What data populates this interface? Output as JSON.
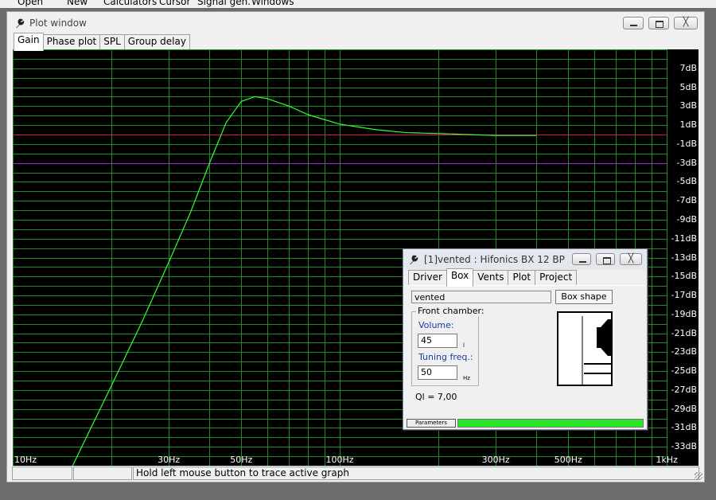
{
  "menu": {
    "items": [
      {
        "label": "Open"
      },
      {
        "label": "New"
      },
      {
        "label": "Calculators"
      },
      {
        "label": "Cursor"
      },
      {
        "label": "Signal gen."
      },
      {
        "label": "Windows"
      }
    ]
  },
  "plot_window": {
    "title": "Plot window",
    "tabs": [
      {
        "label": "Gain",
        "active": true
      },
      {
        "label": "Phase plot",
        "active": false
      },
      {
        "label": "SPL",
        "active": false
      },
      {
        "label": "Group delay",
        "active": false
      }
    ],
    "close_glyph": "╳",
    "status": {
      "cell1": "",
      "cell2": "",
      "message": "Hold left mouse button to trace active graph"
    }
  },
  "chart_data": {
    "type": "line",
    "x_scale": "log",
    "xlim": [
      10,
      1000
    ],
    "ylim": [
      -35,
      9
    ],
    "x_tick_labels": [
      {
        "value": 10,
        "label": "10Hz"
      },
      {
        "value": 30,
        "label": "30Hz"
      },
      {
        "value": 50,
        "label": "50Hz"
      },
      {
        "value": 100,
        "label": "100Hz"
      },
      {
        "value": 300,
        "label": "300Hz"
      },
      {
        "value": 500,
        "label": "500Hz"
      },
      {
        "value": 1000,
        "label": "1kHz"
      }
    ],
    "y_tick_labels": [
      {
        "value": 7,
        "label": "7dB"
      },
      {
        "value": 5,
        "label": "5dB"
      },
      {
        "value": 3,
        "label": "3dB"
      },
      {
        "value": 1,
        "label": "1dB"
      },
      {
        "value": -1,
        "label": "-1dB"
      },
      {
        "value": -3,
        "label": "-3dB"
      },
      {
        "value": -5,
        "label": "-5dB"
      },
      {
        "value": -7,
        "label": "-7dB"
      },
      {
        "value": -9,
        "label": "-9dB"
      },
      {
        "value": -11,
        "label": "-11dB"
      },
      {
        "value": -13,
        "label": "-13dB"
      },
      {
        "value": -15,
        "label": "-15dB"
      },
      {
        "value": -17,
        "label": "-17dB"
      },
      {
        "value": -19,
        "label": "-19dB"
      },
      {
        "value": -21,
        "label": "-21dB"
      },
      {
        "value": -23,
        "label": "-23dB"
      },
      {
        "value": -25,
        "label": "-25dB"
      },
      {
        "value": -27,
        "label": "-27dB"
      },
      {
        "value": -29,
        "label": "-29dB"
      },
      {
        "value": -31,
        "label": "-31dB"
      },
      {
        "value": -33,
        "label": "-33dB"
      }
    ],
    "grid": true,
    "reference_lines": [
      {
        "y": 0,
        "color": "#d02030"
      },
      {
        "y": -3,
        "color": "#a030c0"
      }
    ],
    "series": [
      {
        "color": "#33ff33",
        "x": [
          15,
          20,
          25,
          30,
          35,
          40,
          45,
          50,
          55,
          60,
          70,
          80,
          100,
          130,
          160,
          200,
          250,
          300,
          400
        ],
        "y": [
          -35.5,
          -26.6,
          -19.6,
          -13.5,
          -8.2,
          -3.0,
          1.3,
          3.5,
          4.0,
          3.8,
          3.0,
          2.1,
          1.1,
          0.5,
          0.2,
          0.1,
          0.0,
          -0.1,
          -0.1
        ]
      }
    ]
  },
  "box_dialog": {
    "title": "[1]vented : Hifonics BX 12 BP",
    "close_glyph": "╳",
    "tabs": [
      {
        "label": "Driver",
        "active": false
      },
      {
        "label": "Box",
        "active": true
      },
      {
        "label": "Vents",
        "active": false
      },
      {
        "label": "Plot",
        "active": false
      },
      {
        "label": "Project",
        "active": false
      }
    ],
    "box_type": "vented",
    "box_shape_button": "Box shape",
    "front_chamber": {
      "legend": "Front chamber:",
      "volume_label": "Volume:",
      "volume_value": "45",
      "volume_unit": "l",
      "tuning_label": "Tuning freq.:",
      "tuning_value": "50",
      "tuning_unit": "Hz"
    },
    "ql_text": "Ql = 7,00",
    "parameters_button": "Parameters",
    "progress_fraction": 1.0
  }
}
